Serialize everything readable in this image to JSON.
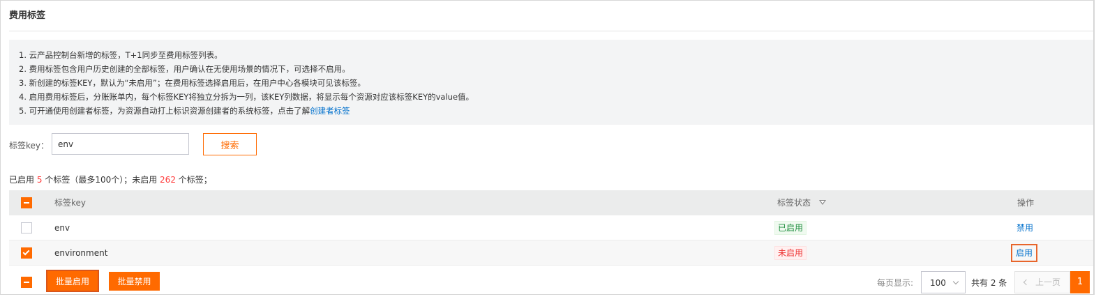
{
  "page": {
    "title": "费用标签"
  },
  "notice": {
    "lines": [
      "1. 云产品控制台新增的标签，T+1同步至费用标签列表。",
      "2. 费用标签包含用户历史创建的全部标签，用户确认在无使用场景的情况下，可选择不启用。",
      "3. 新创建的标签KEY，默认为“未启用”；在费用标签选择启用后，在用户中心各模块可见该标签。",
      "4. 启用费用标签后，分账账单内，每个标签KEY将独立分拆为一列，该KEY列数据，将显示每个资源对应该标签KEY的value值。",
      "5. 可开通使用创建者标签，为资源自动打上标识资源创建者的系统标签，点击了解"
    ],
    "link_text": "创建者标签"
  },
  "filter": {
    "label": "标签key：",
    "value": "env",
    "search_label": "搜索"
  },
  "summary": {
    "prefix": "已启用",
    "enabled_count": "5",
    "middle": "个标签（最多100个）；未启用",
    "disabled_count": "262",
    "suffix": "个标签；"
  },
  "table": {
    "headers": {
      "key": "标签key",
      "status": "标签状态",
      "action": "操作"
    },
    "rows": [
      {
        "key": "env",
        "status": "已启用",
        "action": "禁用",
        "checked": false
      },
      {
        "key": "environment",
        "status": "未启用",
        "action": "启用",
        "checked": true
      }
    ]
  },
  "footer": {
    "batch_enable": "批量启用",
    "batch_disable": "批量禁用",
    "page_size_label": "每页显示:",
    "page_size": "100",
    "total": "共有 2 条",
    "prev": "上一页",
    "current_page": "1"
  },
  "colors": {
    "accent": "#ff6a00",
    "link": "#0070cc",
    "enabled": "#1e8e3e",
    "disabled": "#e33333"
  }
}
